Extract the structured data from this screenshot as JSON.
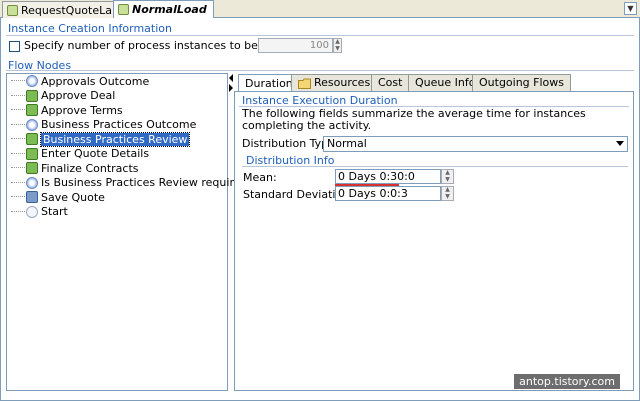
{
  "editor_tabs": [
    {
      "label": "RequestQuoteLab"
    },
    {
      "label": "NormalLoad"
    }
  ],
  "instance_creation": {
    "title": "Instance Creation Information",
    "checkbox_label": "Specify number of process instances to be created",
    "count_value": "100",
    "checked": false
  },
  "flow_nodes": {
    "title": "Flow Nodes",
    "items": [
      {
        "label": "Approvals Outcome",
        "icon": "decision-icon"
      },
      {
        "label": "Approve Deal",
        "icon": "activity-icon"
      },
      {
        "label": "Approve Terms",
        "icon": "activity-icon"
      },
      {
        "label": "Business Practices Outcome",
        "icon": "decision-icon"
      },
      {
        "label": "Business Practices Review",
        "icon": "activity-icon",
        "selected": true
      },
      {
        "label": "Enter Quote Details",
        "icon": "activity-icon"
      },
      {
        "label": "Finalize Contracts",
        "icon": "activity-icon"
      },
      {
        "label": "Is Business Practices Review required?",
        "icon": "decision-icon"
      },
      {
        "label": "Save Quote",
        "icon": "script-icon"
      },
      {
        "label": "Start",
        "icon": "start-icon"
      }
    ]
  },
  "detail_tabs": [
    {
      "label": "Duration",
      "active": true
    },
    {
      "label": "Resources"
    },
    {
      "label": "Cost"
    },
    {
      "label": "Queue Info"
    },
    {
      "label": "Outgoing Flows"
    }
  ],
  "duration": {
    "title": "Instance Execution Duration",
    "description": "The following fields summarize the average time for instances completing the activity.",
    "distribution_type_label": "Distribution Type:",
    "distribution_type_value": "Normal",
    "distribution_info_title": "Distribution Info",
    "mean_label": "Mean:",
    "mean_value": "0 Days 0:30:0",
    "std_label": "Standard Deviation:",
    "std_value": "0 Days 0:0:3"
  },
  "watermark": "antop.tistory.com",
  "colors": {
    "section_label": "#1f5fb8",
    "selection": "#316ac5",
    "annotation_underline": "#d93030"
  }
}
